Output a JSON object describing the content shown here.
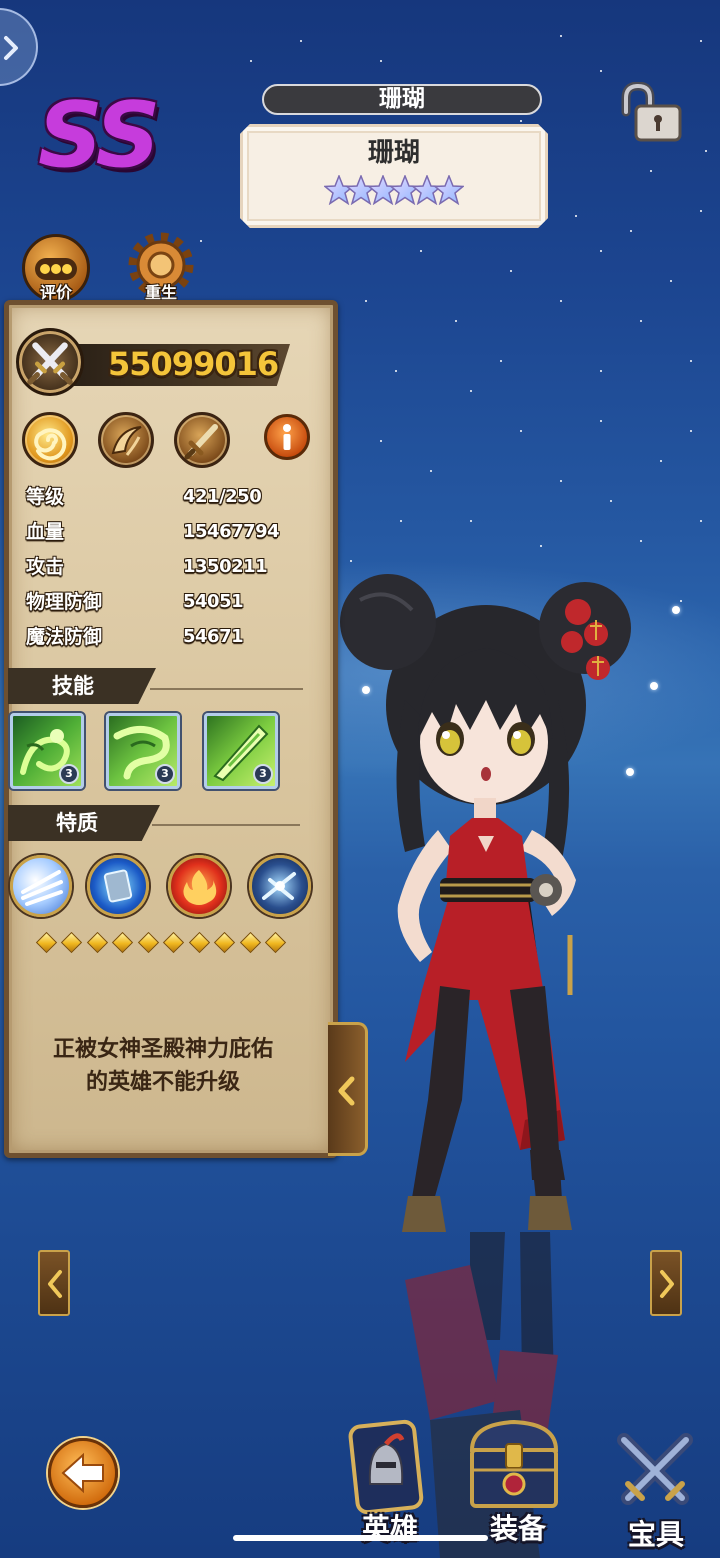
{
  "header": {
    "grade": "SS",
    "name_banner": "珊瑚",
    "card_name": "珊瑚",
    "star_count": 6
  },
  "actions": {
    "review_label": "评价",
    "rebirth_label": "重生"
  },
  "panel": {
    "power": "55099016",
    "stats": [
      {
        "label": "等级",
        "value": "421/250"
      },
      {
        "label": "血量",
        "value": "15467794"
      },
      {
        "label": "攻击",
        "value": "1350211"
      },
      {
        "label": "物理防御",
        "value": "54051"
      },
      {
        "label": "魔法防御",
        "value": "54671"
      }
    ],
    "skills_title": "技能",
    "skills": [
      {
        "icon": "green-dragon-skill-icon",
        "level": "3"
      },
      {
        "icon": "dragon-coil-skill-icon",
        "level": "3"
      },
      {
        "icon": "jade-blade-skill-icon",
        "level": "3"
      }
    ],
    "traits_title": "特质",
    "traits": [
      {
        "icon": "wind-slash-icon"
      },
      {
        "icon": "stone-tablet-icon"
      },
      {
        "icon": "fire-burst-icon"
      },
      {
        "icon": "ice-blade-icon"
      }
    ],
    "rank_diamond_count": 10,
    "notice_lines": [
      "正被女神圣殿神力庇佑",
      "的英雄不能升级"
    ]
  },
  "nav": {
    "hero_label": "英雄",
    "equipment_label": "装备",
    "treasure_label": "宝具"
  },
  "icons": {
    "edge_button": "chevron-right-icon",
    "lock": "unlocked-padlock-icon",
    "review": "more-dots-icon",
    "rebirth": "gear-icon",
    "power": "crossed-swords-icon",
    "attribute_row": [
      "sun-swirl-icon",
      "claw-slash-icon",
      "sword-icon",
      "info-icon"
    ],
    "side_tab": "chevron-left-icon",
    "prev_hero": "chevron-left-icon",
    "next_hero": "chevron-right-icon",
    "back": "back-arrow-icon",
    "nav": [
      "hero-helmet-icon",
      "treasure-chest-icon",
      "crossed-blades-icon"
    ]
  },
  "colors": {
    "grade": "#c63cdc",
    "power": "#f4c43a",
    "panel": "#dccaa6",
    "sky": "#1f4c95",
    "dress": "#b81f27"
  }
}
